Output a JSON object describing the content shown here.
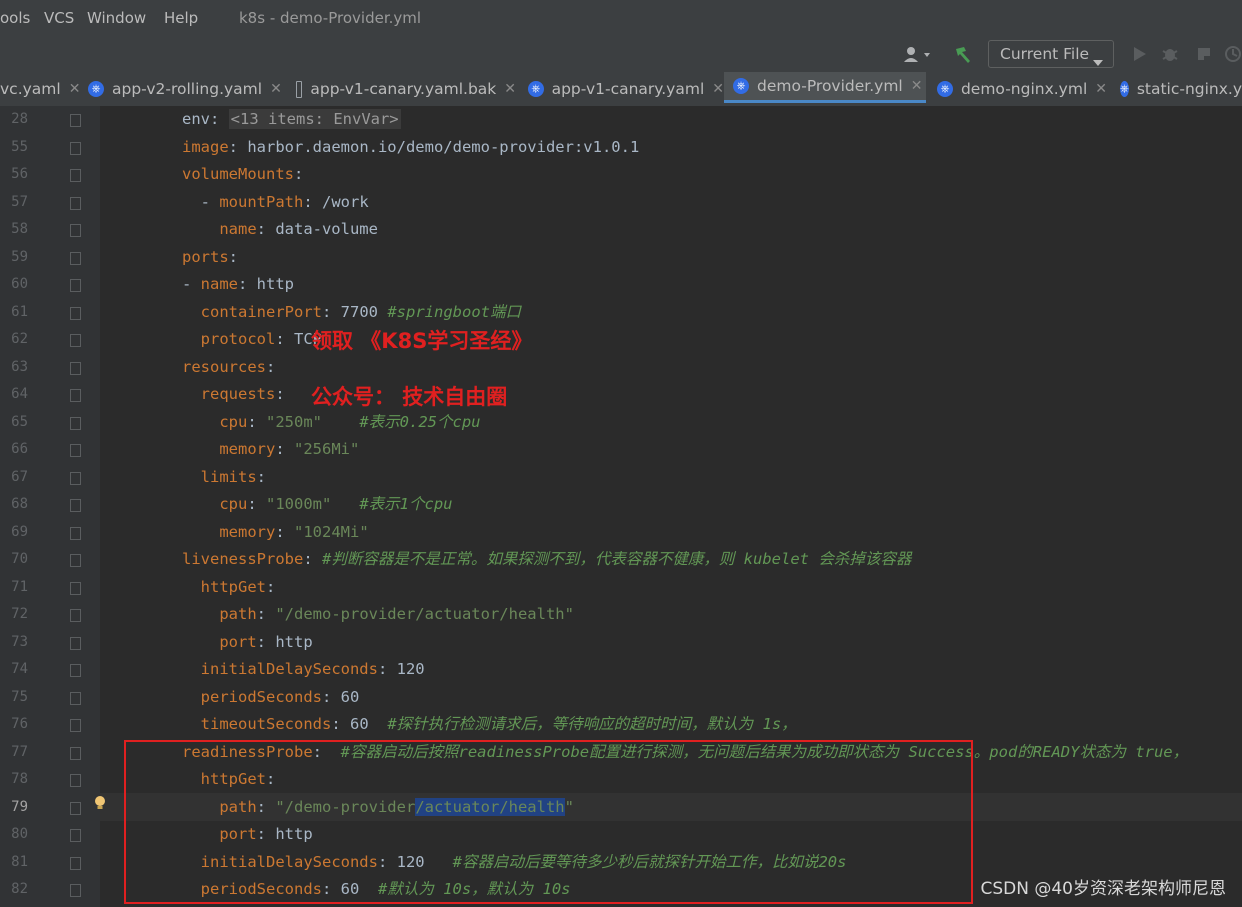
{
  "menu": {
    "items": [
      "ools",
      "VCS",
      "Window",
      "Help"
    ],
    "title": "k8s - demo-Provider.yml"
  },
  "toolbar": {
    "run_config": "Current File"
  },
  "tabs": [
    {
      "label": "vc.yaml",
      "icon": "k8s-icon",
      "active": false
    },
    {
      "label": "app-v2-rolling.yaml",
      "icon": "k8s-icon",
      "active": false
    },
    {
      "label": "app-v1-canary.yaml.bak",
      "icon": "file-icon",
      "active": false
    },
    {
      "label": "app-v1-canary.yaml",
      "icon": "k8s-icon",
      "active": false
    },
    {
      "label": "demo-Provider.yml",
      "icon": "k8s-icon",
      "active": true
    },
    {
      "label": "demo-nginx.yml",
      "icon": "k8s-icon",
      "active": false
    },
    {
      "label": "static-nginx.y",
      "icon": "k8s-icon",
      "active": false
    }
  ],
  "lines": [
    {
      "n": "28",
      "code": [
        [
          "v",
          "env: "
        ],
        [
          "fold",
          "<13 items: EnvVar>"
        ]
      ]
    },
    {
      "n": "55",
      "code": [
        [
          "k",
          "image"
        ],
        [
          "v",
          ": harbor.daemon.io/demo/demo-provider:v1.0.1"
        ]
      ]
    },
    {
      "n": "56",
      "code": [
        [
          "k",
          "volumeMounts"
        ],
        [
          "v",
          ":"
        ]
      ]
    },
    {
      "n": "57",
      "code": [
        [
          "v",
          "  - "
        ],
        [
          "k",
          "mountPath"
        ],
        [
          "v",
          ": /work"
        ]
      ]
    },
    {
      "n": "58",
      "code": [
        [
          "v",
          "    "
        ],
        [
          "k",
          "name"
        ],
        [
          "v",
          ": data-volume"
        ]
      ]
    },
    {
      "n": "59",
      "code": [
        [
          "k",
          "ports"
        ],
        [
          "v",
          ":"
        ]
      ]
    },
    {
      "n": "60",
      "code": [
        [
          "v",
          "- "
        ],
        [
          "k",
          "name"
        ],
        [
          "v",
          ": http"
        ]
      ]
    },
    {
      "n": "61",
      "code": [
        [
          "v",
          "  "
        ],
        [
          "k",
          "containerPort"
        ],
        [
          "v",
          ": 7700 "
        ],
        [
          "c",
          "#springboot端口"
        ]
      ]
    },
    {
      "n": "62",
      "code": [
        [
          "v",
          "  "
        ],
        [
          "k",
          "protocol"
        ],
        [
          "v",
          ": TCP"
        ]
      ]
    },
    {
      "n": "63",
      "code": [
        [
          "k",
          "resources"
        ],
        [
          "v",
          ":"
        ]
      ]
    },
    {
      "n": "64",
      "code": [
        [
          "v",
          "  "
        ],
        [
          "k",
          "requests"
        ],
        [
          "v",
          ":"
        ]
      ]
    },
    {
      "n": "65",
      "code": [
        [
          "v",
          "    "
        ],
        [
          "k",
          "cpu"
        ],
        [
          "v",
          ": "
        ],
        [
          "s",
          "\"250m\""
        ],
        [
          "v",
          "    "
        ],
        [
          "c",
          "#表示0.25个cpu"
        ]
      ]
    },
    {
      "n": "66",
      "code": [
        [
          "v",
          "    "
        ],
        [
          "k",
          "memory"
        ],
        [
          "v",
          ": "
        ],
        [
          "s",
          "\"256Mi\""
        ]
      ]
    },
    {
      "n": "67",
      "code": [
        [
          "v",
          "  "
        ],
        [
          "k",
          "limits"
        ],
        [
          "v",
          ":"
        ]
      ]
    },
    {
      "n": "68",
      "code": [
        [
          "v",
          "    "
        ],
        [
          "k",
          "cpu"
        ],
        [
          "v",
          ": "
        ],
        [
          "s",
          "\"1000m\""
        ],
        [
          "v",
          "   "
        ],
        [
          "c",
          "#表示1个cpu"
        ]
      ]
    },
    {
      "n": "69",
      "code": [
        [
          "v",
          "    "
        ],
        [
          "k",
          "memory"
        ],
        [
          "v",
          ": "
        ],
        [
          "s",
          "\"1024Mi\""
        ]
      ]
    },
    {
      "n": "70",
      "code": [
        [
          "k",
          "livenessProbe"
        ],
        [
          "v",
          ": "
        ],
        [
          "c",
          "#判断容器是不是正常。如果探测不到，代表容器不健康，则 kubelet 会杀掉该容器"
        ]
      ]
    },
    {
      "n": "71",
      "code": [
        [
          "v",
          "  "
        ],
        [
          "k",
          "httpGet"
        ],
        [
          "v",
          ":"
        ]
      ]
    },
    {
      "n": "72",
      "code": [
        [
          "v",
          "    "
        ],
        [
          "k",
          "path"
        ],
        [
          "v",
          ": "
        ],
        [
          "s",
          "\"/demo-provider/actuator/health\""
        ]
      ]
    },
    {
      "n": "73",
      "code": [
        [
          "v",
          "    "
        ],
        [
          "k",
          "port"
        ],
        [
          "v",
          ": http"
        ]
      ]
    },
    {
      "n": "74",
      "code": [
        [
          "v",
          "  "
        ],
        [
          "k",
          "initialDelaySeconds"
        ],
        [
          "v",
          ": 120"
        ]
      ]
    },
    {
      "n": "75",
      "code": [
        [
          "v",
          "  "
        ],
        [
          "k",
          "periodSeconds"
        ],
        [
          "v",
          ": 60"
        ]
      ]
    },
    {
      "n": "76",
      "code": [
        [
          "v",
          "  "
        ],
        [
          "k",
          "timeoutSeconds"
        ],
        [
          "v",
          ": 60  "
        ],
        [
          "c",
          "#探针执行检测请求后，等待响应的超时时间，默认为 1s，"
        ]
      ]
    },
    {
      "n": "77",
      "code": [
        [
          "k",
          "readinessProbe"
        ],
        [
          "v",
          ":  "
        ],
        [
          "c",
          "#容器启动后按照readinessProbe配置进行探测，无问题后结果为成功即状态为 Success。pod的READY状态为 true，"
        ]
      ]
    },
    {
      "n": "78",
      "code": [
        [
          "v",
          "  "
        ],
        [
          "k",
          "httpGet"
        ],
        [
          "v",
          ":"
        ]
      ]
    },
    {
      "n": "79",
      "code": [
        [
          "v",
          "    "
        ],
        [
          "k",
          "path"
        ],
        [
          "v",
          ": "
        ],
        [
          "s",
          "\"/demo-provider"
        ],
        [
          "sel",
          "/actuator/health"
        ],
        [
          "s",
          "\""
        ]
      ]
    },
    {
      "n": "80",
      "code": [
        [
          "v",
          "    "
        ],
        [
          "k",
          "port"
        ],
        [
          "v",
          ": http"
        ]
      ]
    },
    {
      "n": "81",
      "code": [
        [
          "v",
          "  "
        ],
        [
          "k",
          "initialDelaySeconds"
        ],
        [
          "v",
          ": 120   "
        ],
        [
          "c",
          "#容器启动后要等待多少秒后就探针开始工作，比如说20s"
        ]
      ]
    },
    {
      "n": "82",
      "code": [
        [
          "v",
          "  "
        ],
        [
          "k",
          "periodSeconds"
        ],
        [
          "v",
          ": 60  "
        ],
        [
          "c",
          "#默认为 10s，默认为 10s"
        ]
      ]
    }
  ],
  "promo": {
    "line1": "领取 《K8S学习圣经》",
    "line2": "公众号： 技术自由圈"
  },
  "watermark": "CSDN @40岁资深老架构师尼恩",
  "colors": {
    "key": "#cc7832",
    "string": "#6a8759",
    "comment": "#629755",
    "text": "#a9b7c6",
    "highlight": "#e02020",
    "active_tab_underline": "#4a88c7"
  }
}
